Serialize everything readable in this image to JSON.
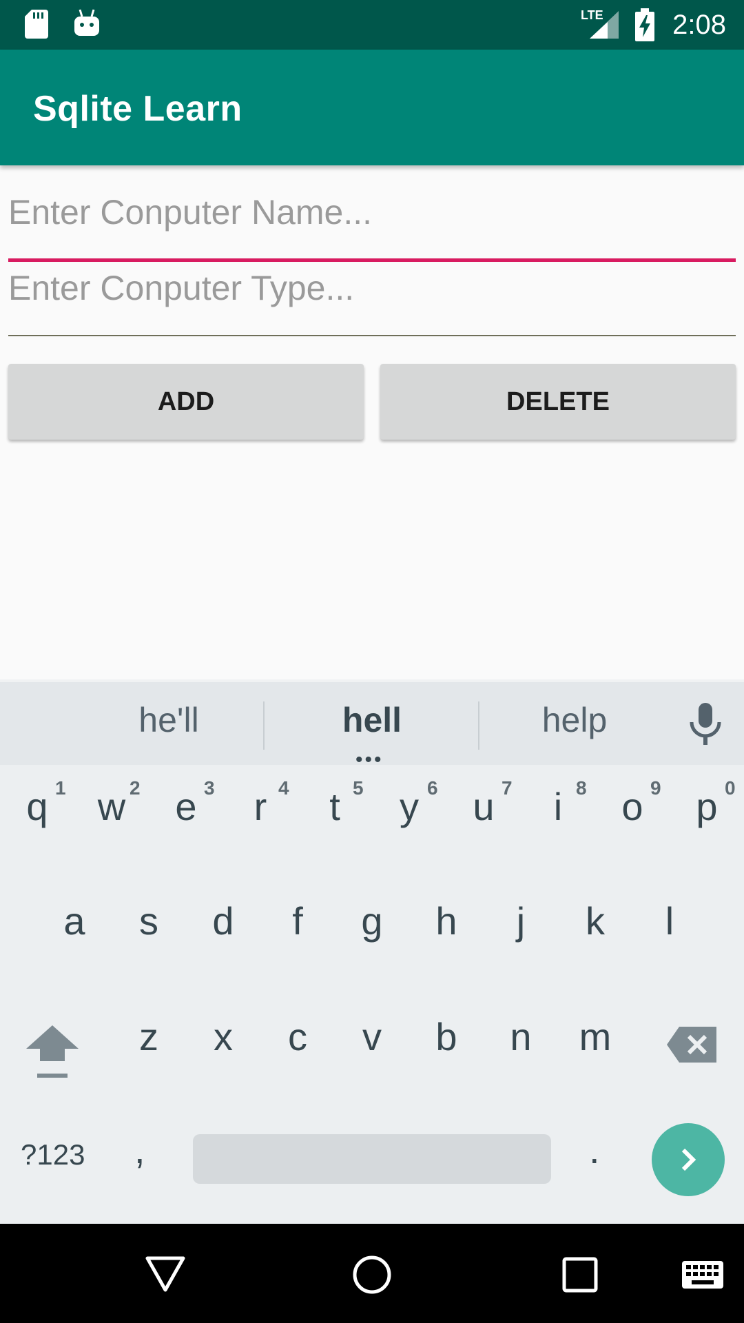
{
  "status_bar": {
    "time": "2:08",
    "network": "LTE"
  },
  "app_bar": {
    "title": "Sqlite Learn"
  },
  "form": {
    "name_placeholder": "Enter Conputer Name...",
    "type_placeholder": "Enter Conputer Type...",
    "add_label": "ADD",
    "delete_label": "DELETE"
  },
  "keyboard": {
    "suggestions": [
      "he'll",
      "hell",
      "help"
    ],
    "row1": [
      "q",
      "w",
      "e",
      "r",
      "t",
      "y",
      "u",
      "i",
      "o",
      "p"
    ],
    "row1_hints": [
      "1",
      "2",
      "3",
      "4",
      "5",
      "6",
      "7",
      "8",
      "9",
      "0"
    ],
    "row2": [
      "a",
      "s",
      "d",
      "f",
      "g",
      "h",
      "j",
      "k",
      "l"
    ],
    "row3": [
      "z",
      "x",
      "c",
      "v",
      "b",
      "n",
      "m"
    ],
    "symbols_label": "?123",
    "comma": ",",
    "period": "."
  },
  "colors": {
    "status_bar": "#00574b",
    "app_bar": "#008577",
    "accent": "#d81b60",
    "enter_key": "#4db6a4"
  }
}
